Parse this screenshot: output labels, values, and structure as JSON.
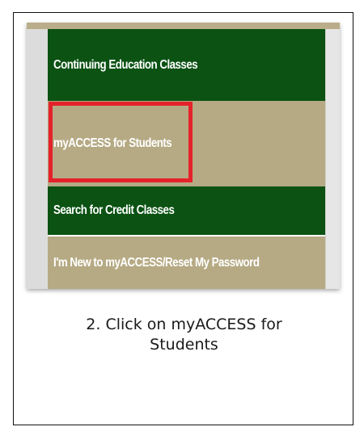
{
  "menu": {
    "items": [
      {
        "label": "Continuing Education Classes"
      },
      {
        "label": "myACCESS for Students"
      },
      {
        "label": "Search for Credit Classes"
      },
      {
        "label": "I'm New to myACCESS/Reset My Password"
      }
    ],
    "colors": {
      "green": "#0b5213",
      "tan": "#b6aa84",
      "highlight": "#e5222b"
    }
  },
  "caption": {
    "line1": "2. Click on myACCESS for",
    "line2": "Students"
  }
}
